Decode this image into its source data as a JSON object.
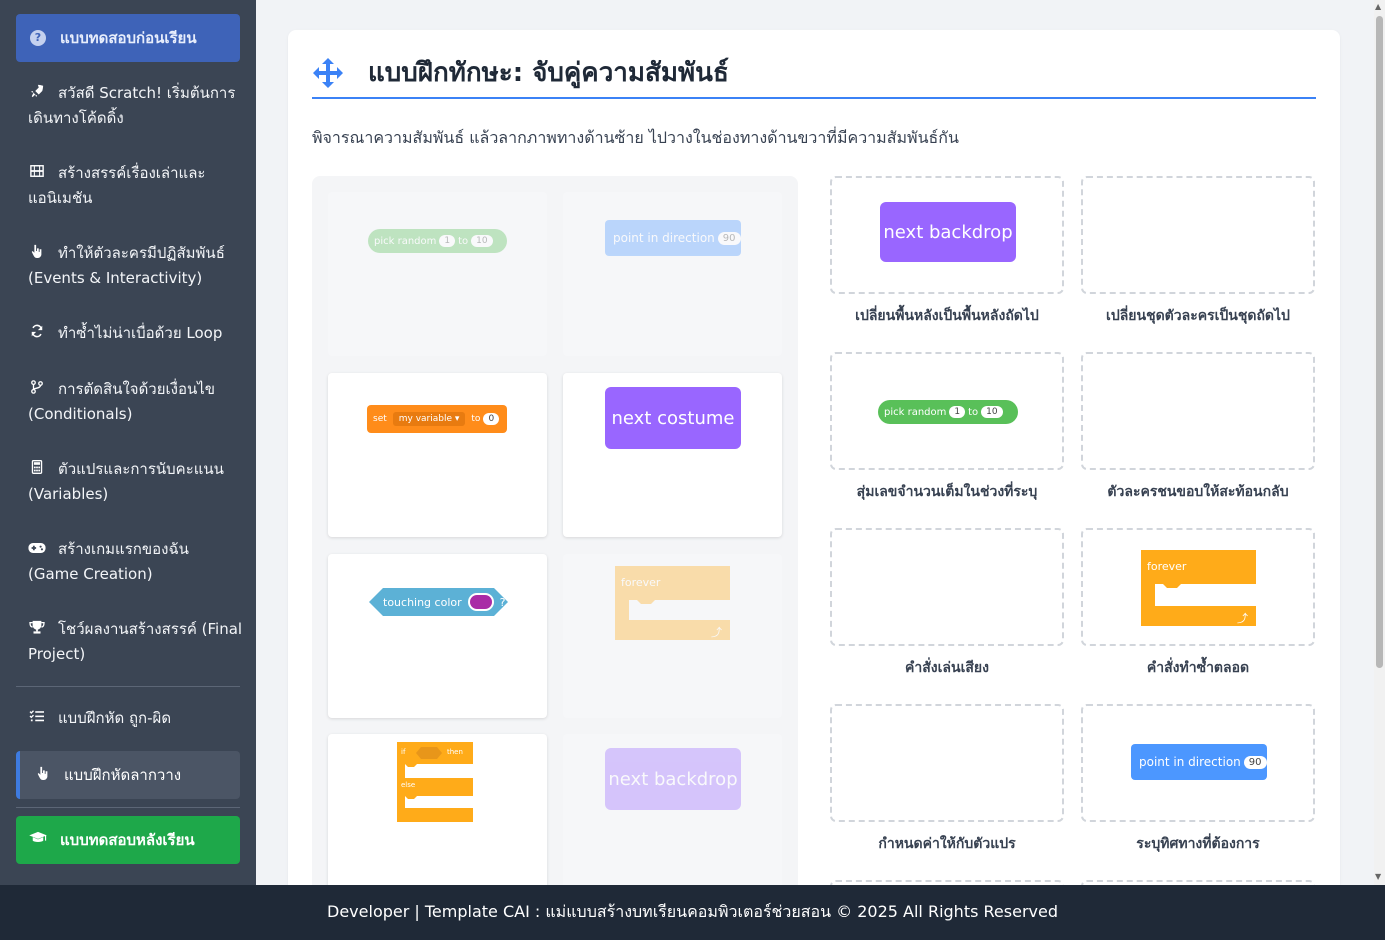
{
  "sidebar": {
    "pre_test": "แบบทดสอบก่อนเรียน",
    "items": [
      {
        "label": "สวัสดี Scratch! เริ่มต้นการเดินทางโค้ดดิ้ง",
        "icon": "rocket-icon"
      },
      {
        "label": "สร้างสรรค์เรื่องเล่าและแอนิเมชัน",
        "icon": "film-icon"
      },
      {
        "label": "ทำให้ตัวละครมีปฏิสัมพันธ์ (Events & Interactivity)",
        "icon": "pointer-icon"
      },
      {
        "label": "ทำซ้ำไม่น่าเบื่อด้วย Loop",
        "icon": "repeat-icon"
      },
      {
        "label": "การตัดสินใจด้วยเงื่อนไข (Conditionals)",
        "icon": "branch-icon"
      },
      {
        "label": "ตัวแปรและการนับคะแนน (Variables)",
        "icon": "calculator-icon"
      },
      {
        "label": "สร้างเกมแรกของฉัน (Game Creation)",
        "icon": "gamepad-icon"
      },
      {
        "label": "โชว์ผลงานสร้างสรรค์ (Final Project)",
        "icon": "trophy-icon"
      }
    ],
    "exercise_truefalse": "แบบฝึกหัด ถูก-ผิด",
    "exercise_drag": "แบบฝึกหัดลากวาง",
    "post_test": "แบบทดสอบหลังเรียน"
  },
  "main": {
    "title": "แบบฝึกทักษะ: จับคู่ความสัมพันธ์",
    "instruction": "พิจารณาความสัมพันธ์ แล้วลากภาพทางด้านซ้าย ไปวางในช่องทางด้านขวาที่มีความสัมพันธ์กัน"
  },
  "blocks": {
    "pick_random": {
      "text": "pick random",
      "a": "1",
      "to": "to",
      "b": "10"
    },
    "point_dir": {
      "text": "point in direction",
      "value": "90"
    },
    "set_var": {
      "set": "set",
      "var": "my variable ▾",
      "to": "to",
      "value": "0"
    },
    "next_costume": "next costume",
    "touching_color": {
      "text": "touching color",
      "q": "?"
    },
    "forever": "forever",
    "if_else": {
      "if": "if",
      "then": "then",
      "else": "else"
    },
    "next_backdrop": "next backdrop"
  },
  "targets": [
    {
      "label": "เปลี่ยนพื้นหลังเป็นพื้นหลังถัดไป"
    },
    {
      "label": "เปลี่ยนชุดตัวละครเป็นชุดถัดไป"
    },
    {
      "label": "สุ่มเลขจำนวนเต็มในช่วงที่ระบุ"
    },
    {
      "label": "ตัวละครชนขอบให้สะท้อนกลับ"
    },
    {
      "label": "คำสั่งเล่นเสียง"
    },
    {
      "label": "คำสั่งทำซ้ำตลอด"
    },
    {
      "label": "กำหนดค่าให้กับตัวแปร"
    },
    {
      "label": "ระบุทิศทางที่ต้องการ"
    }
  ],
  "footer": "Developer | Template CAI : แม่แบบสร้างบทเรียนคอมพิวเตอร์ช่วยสอน © 2025 All Rights Reserved",
  "colors": {
    "sidebar": "#3b4554",
    "primary": "#3b82f6",
    "success": "#1ea84a",
    "looks": "#9966ff",
    "motion": "#4c97ff",
    "control": "#ffab19",
    "variables": "#ff8c1a",
    "operators": "#59c059",
    "sensing": "#5cb1d6"
  }
}
